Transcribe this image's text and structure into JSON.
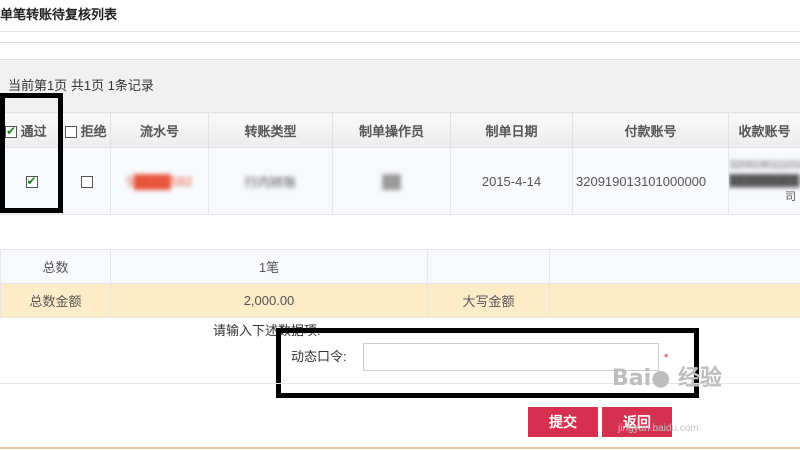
{
  "page": {
    "title": "单笔转账待复核列表"
  },
  "pager": {
    "text": "当前第1页 共1页 1条记录"
  },
  "table": {
    "columns": [
      "通过",
      "拒绝",
      "流水号",
      "转账类型",
      "制单操作员",
      "制单日期",
      "付款账号",
      "收款账号"
    ],
    "row": {
      "approve_checked": true,
      "reject_checked": false,
      "serial_no": "5████592",
      "transfer_type": "行内转账",
      "operator": "██",
      "date": "2015-4-14",
      "payer_account": "320919013101000000",
      "payee_account_line1": "3209190111010",
      "payee_account_line2": "█████████支行",
      "payee_account_line3": "司"
    }
  },
  "summary": {
    "count_label": "总数",
    "count_value": "1笔",
    "amount_label": "总数金额",
    "amount_value": "2,000.00",
    "amount_upper_label": "大写金额",
    "amount_upper_value": ""
  },
  "form": {
    "hint": "请输入下述数据项:",
    "otp_label": "动态口令:",
    "otp_value": "",
    "required_mark": "*"
  },
  "buttons": {
    "submit": "提交",
    "back": "返回"
  },
  "watermark": {
    "text": "Bai● 经验",
    "sub": "jingyan.baidu.com"
  }
}
